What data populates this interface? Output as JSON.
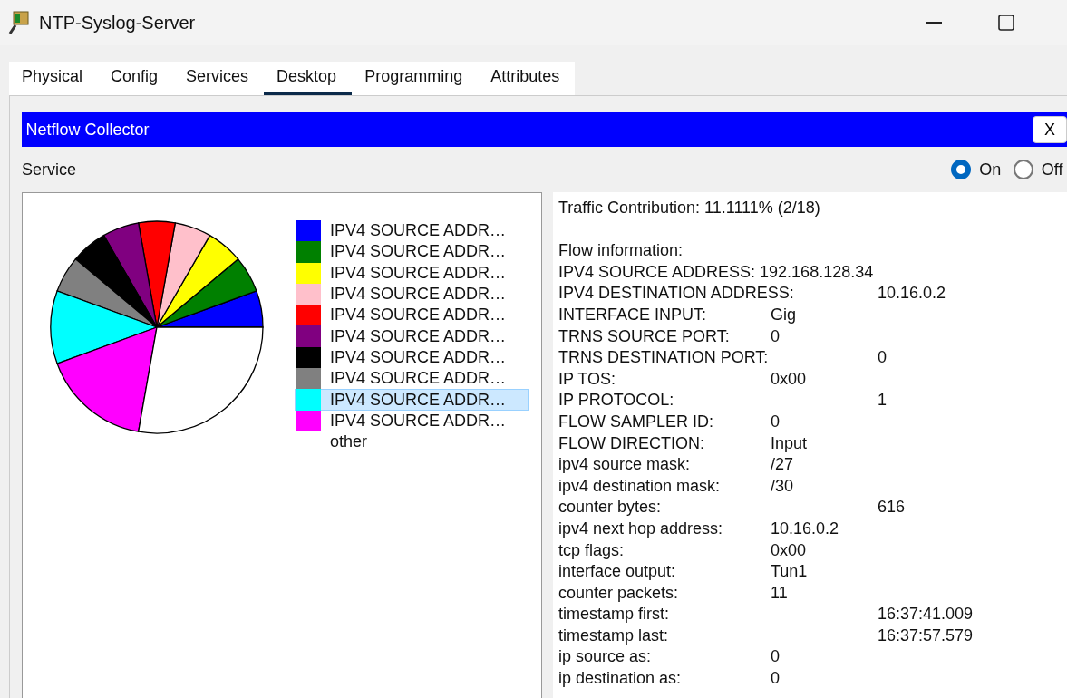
{
  "window": {
    "title": "NTP-Syslog-Server"
  },
  "tabs": [
    {
      "label": "Physical",
      "selected": false
    },
    {
      "label": "Config",
      "selected": false
    },
    {
      "label": "Services",
      "selected": false
    },
    {
      "label": "Desktop",
      "selected": true
    },
    {
      "label": "Programming",
      "selected": false
    },
    {
      "label": "Attributes",
      "selected": false
    }
  ],
  "app": {
    "title": "Netflow Collector",
    "close_label": "X",
    "service_label": "Service",
    "service_options": [
      {
        "label": "On",
        "selected": true
      },
      {
        "label": "Off",
        "selected": false
      }
    ]
  },
  "legend": [
    {
      "label": "IPV4 SOURCE ADDR…",
      "color": "#0000ff",
      "selected": false
    },
    {
      "label": "IPV4 SOURCE ADDR…",
      "color": "#008000",
      "selected": false
    },
    {
      "label": "IPV4 SOURCE ADDR…",
      "color": "#ffff00",
      "selected": false
    },
    {
      "label": "IPV4 SOURCE ADDR…",
      "color": "#ffc0cb",
      "selected": false
    },
    {
      "label": "IPV4 SOURCE ADDR…",
      "color": "#ff0000",
      "selected": false
    },
    {
      "label": "IPV4 SOURCE ADDR…",
      "color": "#800080",
      "selected": false
    },
    {
      "label": "IPV4 SOURCE ADDR…",
      "color": "#000000",
      "selected": false
    },
    {
      "label": "IPV4 SOURCE ADDR…",
      "color": "#808080",
      "selected": false
    },
    {
      "label": "IPV4 SOURCE ADDR…",
      "color": "#00ffff",
      "selected": true
    },
    {
      "label": "IPV4 SOURCE ADDR…",
      "color": "#ff00ff",
      "selected": false
    },
    {
      "label": "other",
      "selected": false
    }
  ],
  "details": {
    "traffic_contribution": "Traffic Contribution: 11.1111% (2/18)",
    "heading": "Flow information:",
    "fields": [
      {
        "label": "IPV4 SOURCE ADDRESS:",
        "value": "192.168.128.34",
        "kind": "inline"
      },
      {
        "label": "IPV4 DESTINATION ADDRESS:",
        "value": "10.16.0.2",
        "kind": "far"
      },
      {
        "label": "INTERFACE INPUT:",
        "value": "Gig",
        "kind": "near"
      },
      {
        "label": "TRNS SOURCE PORT:",
        "value": "0",
        "kind": "near"
      },
      {
        "label": "TRNS DESTINATION PORT:",
        "value": "0",
        "kind": "far"
      },
      {
        "label": "IP TOS:",
        "value": "0x00",
        "kind": "near"
      },
      {
        "label": "IP PROTOCOL:",
        "value": "1",
        "kind": "far"
      },
      {
        "label": "FLOW SAMPLER ID:",
        "value": "0",
        "kind": "near"
      },
      {
        "label": "FLOW DIRECTION:",
        "value": "Input",
        "kind": "near"
      },
      {
        "label": "ipv4 source mask:",
        "value": "/27",
        "kind": "near"
      },
      {
        "label": "ipv4 destination mask:",
        "value": "/30",
        "kind": "near"
      },
      {
        "label": "counter bytes:",
        "value": "616",
        "kind": "far"
      },
      {
        "label": "ipv4 next hop address:",
        "value": "10.16.0.2",
        "kind": "near"
      },
      {
        "label": "tcp flags:",
        "value": "0x00",
        "kind": "near"
      },
      {
        "label": "interface output:",
        "value": "Tun1",
        "kind": "near"
      },
      {
        "label": "counter packets:",
        "value": "11",
        "kind": "near"
      },
      {
        "label": "timestamp first:",
        "value": "16:37:41.009",
        "kind": "far"
      },
      {
        "label": "timestamp last:",
        "value": "16:37:57.579",
        "kind": "far"
      },
      {
        "label": "ip source as:",
        "value": "0",
        "kind": "near"
      },
      {
        "label": "ip destination as:",
        "value": "0",
        "kind": "near"
      }
    ]
  }
}
